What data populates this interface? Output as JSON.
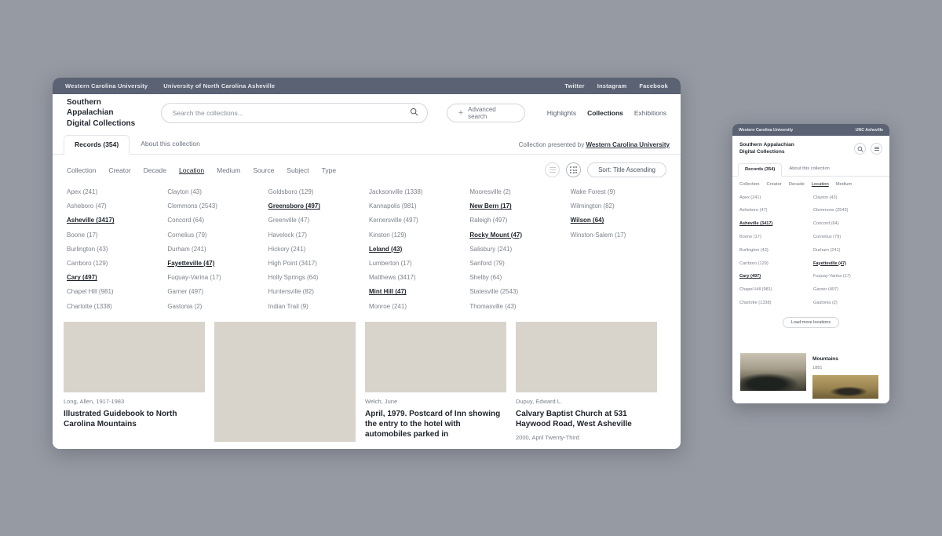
{
  "background_color": "#969aa3",
  "desktop": {
    "topbar": {
      "links": [
        {
          "label": "Western Carolina University"
        },
        {
          "label": "University of North Carolina Asheville"
        }
      ],
      "social": [
        {
          "label": "Twitter"
        },
        {
          "label": "Instagram"
        },
        {
          "label": "Facebook"
        }
      ]
    },
    "brand": "Southern Appalachian\nDigital Collections",
    "search": {
      "placeholder": "Search the collections...",
      "value": "",
      "icon": "search-icon"
    },
    "advanced_search": {
      "label": "Advanced search",
      "icon": "plus-icon"
    },
    "nav": [
      {
        "label": "Highlights",
        "active": false
      },
      {
        "label": "Collections",
        "active": true
      },
      {
        "label": "Exhibitions",
        "active": false
      }
    ],
    "tabs": [
      {
        "label": "Records (354)",
        "active": true
      },
      {
        "label": "About this collection",
        "active": false
      }
    ],
    "presented_by": {
      "prefix": "Collection presented by",
      "name": "Western Carolina University"
    },
    "facet_categories": [
      {
        "label": "Collection",
        "selected": false
      },
      {
        "label": "Creator",
        "selected": false
      },
      {
        "label": "Decade",
        "selected": false
      },
      {
        "label": "Location",
        "selected": true
      },
      {
        "label": "Medium",
        "selected": false
      },
      {
        "label": "Source",
        "selected": false
      },
      {
        "label": "Subject",
        "selected": false
      },
      {
        "label": "Type",
        "selected": false
      }
    ],
    "view_toggles": [
      {
        "icon": "list-view-icon",
        "active": false
      },
      {
        "icon": "grid-view-icon",
        "active": true
      }
    ],
    "sort": {
      "label": "Sort: Title Ascending"
    },
    "locations": [
      [
        {
          "label": "Apex (241)",
          "on": false
        },
        {
          "label": "Asheboro (47)",
          "on": false
        },
        {
          "label": "Asheville (3417)",
          "on": true
        },
        {
          "label": "Boone (17)",
          "on": false
        },
        {
          "label": "Burlington (43)",
          "on": false
        },
        {
          "label": "Carrboro (129)",
          "on": false
        },
        {
          "label": "Cary (497)",
          "on": true
        },
        {
          "label": "Chapel Hill (981)",
          "on": false
        },
        {
          "label": "Charlotte (1338)",
          "on": false
        }
      ],
      [
        {
          "label": "Clayton (43)",
          "on": false
        },
        {
          "label": "Clemmons (2543)",
          "on": false
        },
        {
          "label": "Concord (64)",
          "on": false
        },
        {
          "label": "Cornelius (79)",
          "on": false
        },
        {
          "label": "Durham (241)",
          "on": false
        },
        {
          "label": "Fayetteville (47)",
          "on": true
        },
        {
          "label": "Fuquay-Varina (17)",
          "on": false
        },
        {
          "label": "Garner (497)",
          "on": false
        },
        {
          "label": "Gastonia (2)",
          "on": false
        }
      ],
      [
        {
          "label": "Goldsboro (129)",
          "on": false
        },
        {
          "label": "Greensboro (497)",
          "on": true
        },
        {
          "label": "Greenville (47)",
          "on": false
        },
        {
          "label": "Havelock (17)",
          "on": false
        },
        {
          "label": "Hickory (241)",
          "on": false
        },
        {
          "label": "High Point (3417)",
          "on": false
        },
        {
          "label": "Holly Springs (64)",
          "on": false
        },
        {
          "label": "Huntersville (82)",
          "on": false
        },
        {
          "label": "Indian Trail (9)",
          "on": false
        }
      ],
      [
        {
          "label": "Jacksonville (1338)",
          "on": false
        },
        {
          "label": "Kannapolis (981)",
          "on": false
        },
        {
          "label": "Kernersville (497)",
          "on": false
        },
        {
          "label": "Kinston (129)",
          "on": false
        },
        {
          "label": "Leland (43)",
          "on": true
        },
        {
          "label": "Lumberton (17)",
          "on": false
        },
        {
          "label": "Matthews (3417)",
          "on": false
        },
        {
          "label": "Mint Hill (47)",
          "on": true
        },
        {
          "label": "Monroe (241)",
          "on": false
        }
      ],
      [
        {
          "label": "Mooresville (2)",
          "on": false
        },
        {
          "label": "New Bern (17)",
          "on": true
        },
        {
          "label": "Raleigh (497)",
          "on": false
        },
        {
          "label": "Rocky Mount (47)",
          "on": true
        },
        {
          "label": "Salisbury (241)",
          "on": false
        },
        {
          "label": "Sanford (79)",
          "on": false
        },
        {
          "label": "Shelby (64)",
          "on": false
        },
        {
          "label": "Statesville (2543)",
          "on": false
        },
        {
          "label": "Thomasville (43)",
          "on": false
        }
      ],
      [
        {
          "label": "Wake Forest (9)",
          "on": false
        },
        {
          "label": "Wilmington (82)",
          "on": false
        },
        {
          "label": "Wilson (64)",
          "on": true
        },
        {
          "label": "Winston-Salem (17)",
          "on": false
        }
      ]
    ],
    "results": [
      {
        "creator": "Long, Allen, 1917-1983",
        "title": "Illustrated Guidebook to North Carolina Mountains",
        "date": "",
        "image": "handwritten-letter-thumbnail"
      },
      {
        "creator": "",
        "title": "",
        "date": "",
        "image": "rocky-cliff-photograph-thumbnail"
      },
      {
        "creator": "Welch, June",
        "title": "April, 1979. Postcard of Inn showing the entry to the hotel with automobiles parked in",
        "date": "",
        "image": "dirt-road-photograph-thumbnail"
      },
      {
        "creator": "Dupuy, Edward L.",
        "title": "Calvary Baptist Church at 531 Haywood Road, West Asheville",
        "date": "2000, April Twenty-Third",
        "image": "orange-flowers-photograph-thumbnail"
      }
    ]
  },
  "mobile": {
    "topbar": {
      "left": "Western Carolina University",
      "right": "UNC Asheville"
    },
    "brand": "Southern Appalachian\nDigital Collections",
    "icons": [
      {
        "name": "search-icon"
      },
      {
        "name": "hamburger-menu-icon"
      }
    ],
    "tabs": [
      {
        "label": "Records (354)",
        "active": true
      },
      {
        "label": "About this collection",
        "active": false
      }
    ],
    "facet_categories": [
      {
        "label": "Collection",
        "selected": false
      },
      {
        "label": "Creator",
        "selected": false
      },
      {
        "label": "Decade",
        "selected": false
      },
      {
        "label": "Location",
        "selected": true
      },
      {
        "label": "Medium",
        "selected": false
      }
    ],
    "locations": [
      [
        {
          "label": "Apex (241)",
          "on": false
        },
        {
          "label": "Asheboro (47)",
          "on": false
        },
        {
          "label": "Asheville (3417)",
          "on": true
        },
        {
          "label": "Boone (17)",
          "on": false
        },
        {
          "label": "Burlington (43)",
          "on": false
        },
        {
          "label": "Carrboro (129)",
          "on": false
        },
        {
          "label": "Cary (497)",
          "on": true
        },
        {
          "label": "Chapel Hill (981)",
          "on": false
        },
        {
          "label": "Charlotte (1338)",
          "on": false
        }
      ],
      [
        {
          "label": "Clayton (43)",
          "on": false
        },
        {
          "label": "Clemmons (2543)",
          "on": false
        },
        {
          "label": "Concord (64)",
          "on": false
        },
        {
          "label": "Cornelius (79)",
          "on": false
        },
        {
          "label": "Durham (241)",
          "on": false
        },
        {
          "label": "Fayetteville (47)",
          "on": true
        },
        {
          "label": "Fuquay-Varina (17)",
          "on": false
        },
        {
          "label": "Garner (497)",
          "on": false
        },
        {
          "label": "Gastonia (2)",
          "on": false
        }
      ]
    ],
    "load_more": {
      "label": "Load more locations"
    },
    "results": [
      {
        "title": "",
        "date": "",
        "image": "mountain-hills-photograph-thumbnail"
      },
      {
        "title": "Mountains",
        "date": "1881",
        "image": "field-photograph-thumbnail"
      }
    ]
  }
}
